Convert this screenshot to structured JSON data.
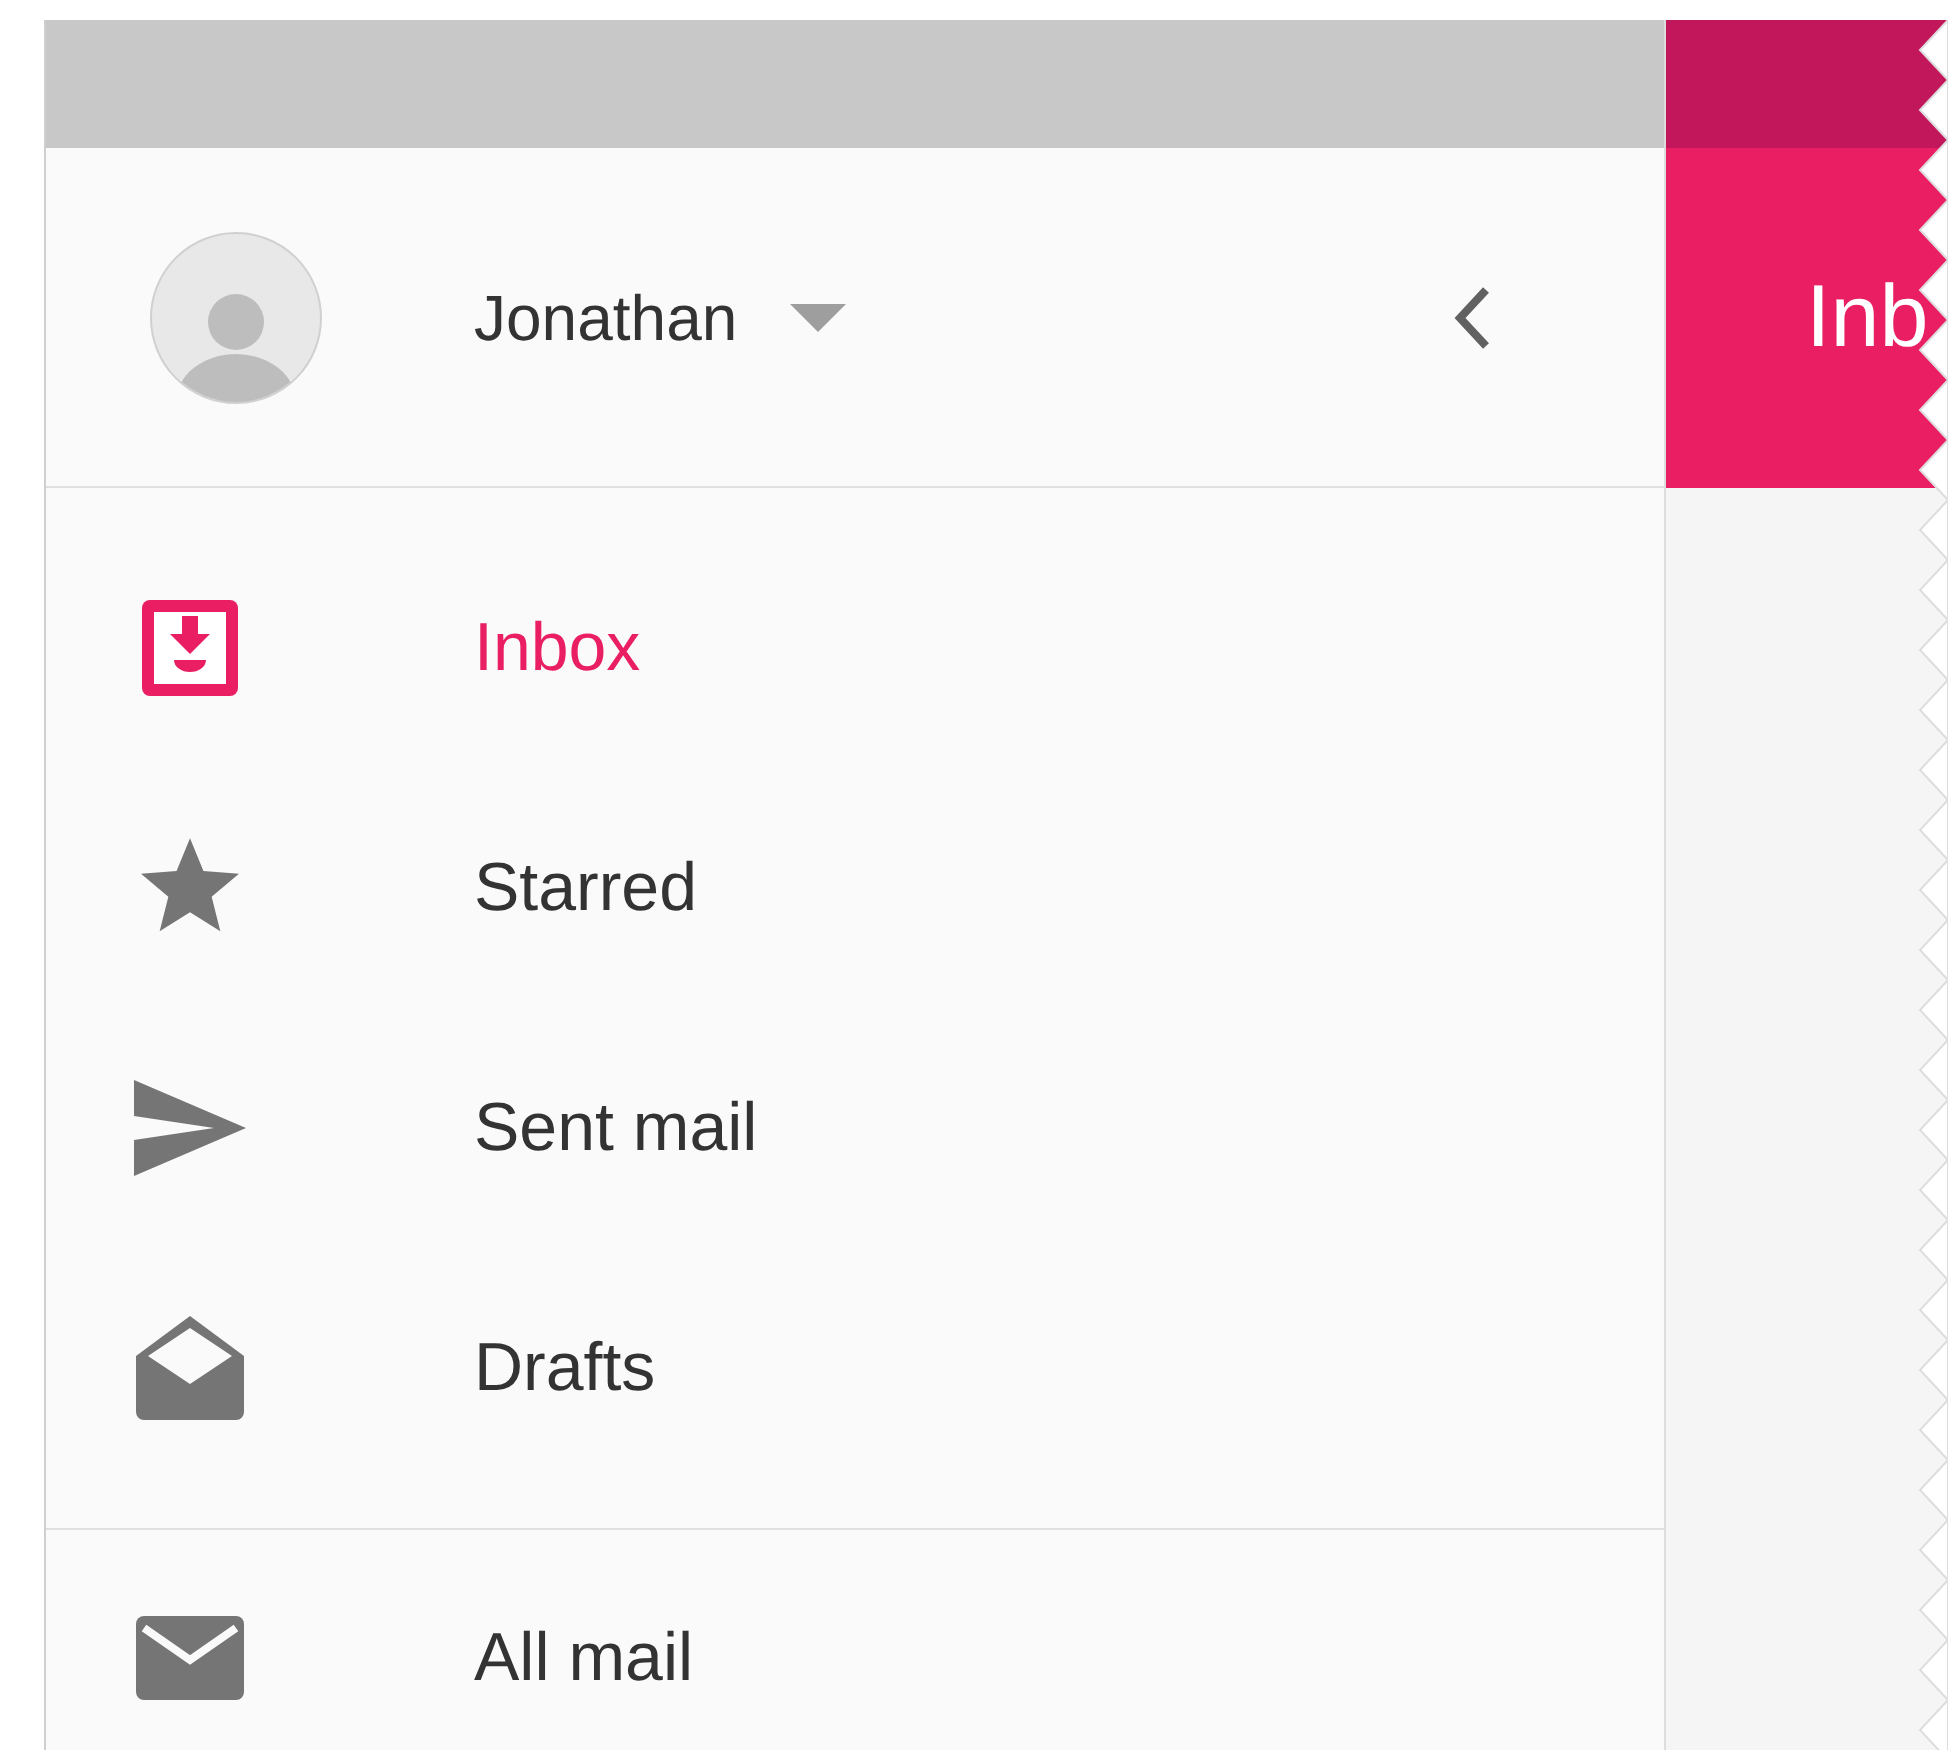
{
  "account": {
    "name": "Jonathan"
  },
  "nav_items": [
    {
      "label": "Inbox",
      "kind": "inbox",
      "selected": true
    },
    {
      "label": "Starred",
      "kind": "star",
      "selected": false
    },
    {
      "label": "Sent mail",
      "kind": "send",
      "selected": false
    },
    {
      "label": "Drafts",
      "kind": "drafts",
      "selected": false
    }
  ],
  "secondary_items": [
    {
      "label": "All mail",
      "kind": "mail",
      "selected": false
    }
  ],
  "header": {
    "title": "Inb"
  }
}
